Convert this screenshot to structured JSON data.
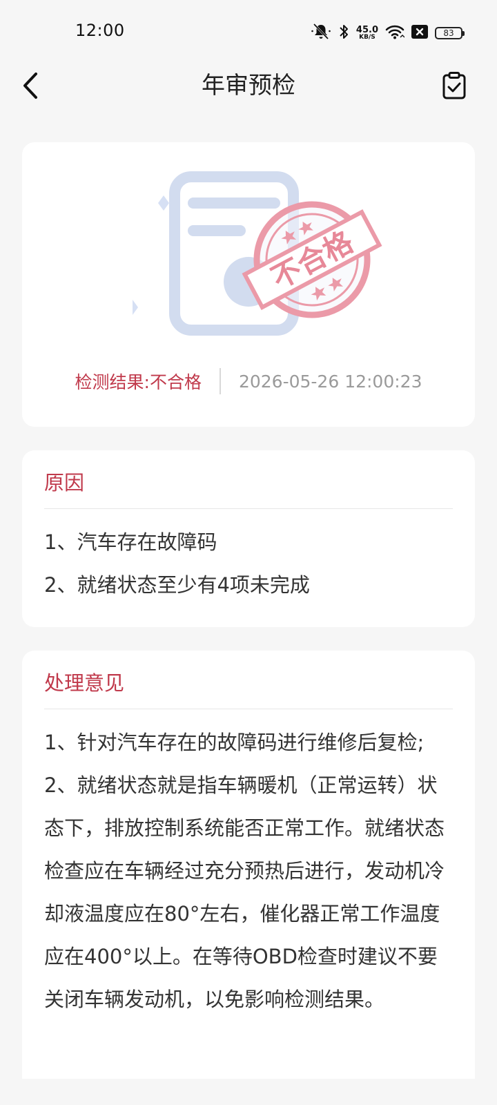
{
  "status_bar": {
    "time": "12:00",
    "net_speed_value": "45.0",
    "net_speed_unit": "KB/S",
    "battery": "83",
    "icons": [
      "bell-off-icon",
      "bluetooth-icon",
      "wifi-icon",
      "no-sim-icon",
      "battery-icon"
    ]
  },
  "header": {
    "title": "年审预检",
    "back_icon": "chevron-left-icon",
    "action_icon": "clipboard-check-icon"
  },
  "result": {
    "stamp_text": "不合格",
    "label": "检测结果:不合格",
    "datetime": "2026-05-26 12:00:23",
    "accent_color": "#c0394b"
  },
  "reason": {
    "title": "原因",
    "items": [
      "1、汽车存在故障码",
      "2、就绪状态至少有4项未完成"
    ]
  },
  "advice": {
    "title": "处理意见",
    "paragraphs": [
      "1、针对汽车存在的故障码进行维修后复检;",
      "2、就绪状态就是指车辆暖机（正常运转）状态下，排放控制系统能否正常工作。就绪状态检查应在车辆经过充分预热后进行，发动机冷却液温度应在80°左右，催化器正常工作温度应在400°以上。在等待OBD检查时建议不要关闭车辆发动机，以免影响检测结果。"
    ]
  }
}
